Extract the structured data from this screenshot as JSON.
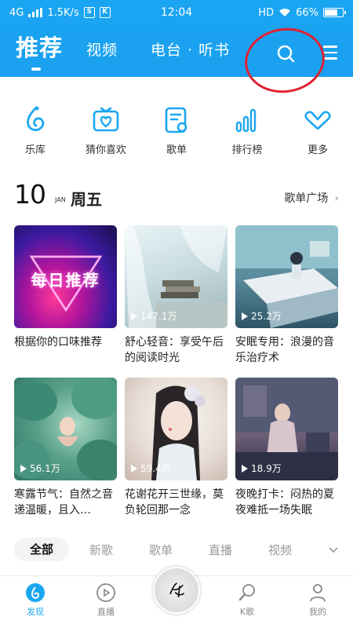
{
  "status": {
    "network": "4G",
    "speed": "1.5K/s",
    "time": "12:04",
    "hd": "HD",
    "battery": "66%"
  },
  "nav": {
    "tabs": [
      "推荐",
      "视频",
      "电台 · 听书"
    ]
  },
  "shortcuts": [
    {
      "label": "乐库",
      "icon": "music-library-icon"
    },
    {
      "label": "猜你喜欢",
      "icon": "heart-box-icon"
    },
    {
      "label": "歌单",
      "icon": "playlist-icon"
    },
    {
      "label": "排行榜",
      "icon": "chart-bars-icon"
    },
    {
      "label": "更多",
      "icon": "chevron-more-icon"
    }
  ],
  "daily": {
    "day": "10",
    "month": "JAN",
    "weekday": "周五",
    "more_label": "歌单广场",
    "more_chevron": "›"
  },
  "cards": [
    {
      "overlay": "每日推荐",
      "plays": "",
      "title": "根据你的口味推荐"
    },
    {
      "overlay": "",
      "plays": "147.1万",
      "title": "舒心轻音：享受午后的阅读时光"
    },
    {
      "overlay": "",
      "plays": "25.2万",
      "title": "安眠专用：浪漫的音乐治疗术"
    },
    {
      "overlay": "",
      "plays": "56.1万",
      "title": "寒露节气：自然之音递温暖，且入…"
    },
    {
      "overlay": "",
      "plays": "59.4万",
      "title": "花谢花开三世缘，莫负轮回那一念"
    },
    {
      "overlay": "",
      "plays": "18.9万",
      "title": "夜晚打卡：闷热的夏夜难抵一场失眠"
    }
  ],
  "categories": [
    "全部",
    "新歌",
    "歌单",
    "直播",
    "视频"
  ],
  "bottom_nav": [
    {
      "label": "发现",
      "icon": "discover-icon"
    },
    {
      "label": "直播",
      "icon": "live-icon"
    },
    {
      "label": "",
      "icon": "album-disc-icon"
    },
    {
      "label": "K歌",
      "icon": "karaoke-icon"
    },
    {
      "label": "我的",
      "icon": "profile-icon"
    }
  ],
  "colors": {
    "brand_blue": "#1aa5f2",
    "active_tab": "#1ba7f0",
    "annotation_red": "#e02232"
  }
}
